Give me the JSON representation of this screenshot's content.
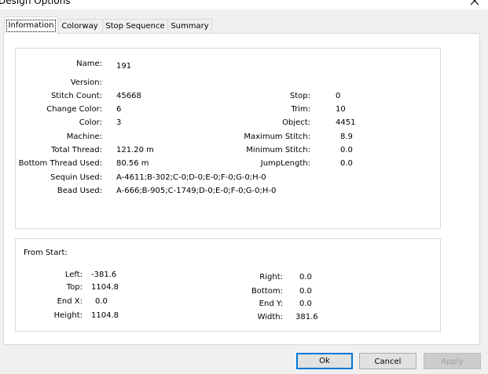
{
  "window": {
    "title": "Design Options"
  },
  "tabs": [
    {
      "label": "Information"
    },
    {
      "label": "Colorway"
    },
    {
      "label": "Stop Sequence"
    },
    {
      "label": "Summary"
    }
  ],
  "info": {
    "name": {
      "label": "Name:",
      "value": "191"
    },
    "version": {
      "label": "Version:",
      "value": ""
    },
    "stitch_count": {
      "label": "Stitch Count:",
      "value": "45668"
    },
    "change_color": {
      "label": "Change Color:",
      "value": "6"
    },
    "color": {
      "label": "Color:",
      "value": "3"
    },
    "machine": {
      "label": "Machine:",
      "value": ""
    },
    "total_thread": {
      "label": "Total Thread:",
      "value": "121.20 m"
    },
    "bottom_thread_used": {
      "label": "Bottom Thread Used:",
      "value": "80.56 m"
    },
    "sequin_used": {
      "label": "Sequin Used:",
      "value": "A-4611;B-302;C-0;D-0;E-0;F-0;G-0;H-0"
    },
    "bead_used": {
      "label": "Bead Used:",
      "value": "A-666;B-905;C-1749;D-0;E-0;F-0;G-0;H-0"
    },
    "stop": {
      "label": "Stop:",
      "value": "0"
    },
    "trim": {
      "label": "Trim:",
      "value": "10"
    },
    "object": {
      "label": "Object:",
      "value": "4451"
    },
    "maximum_stitch": {
      "label": "Maximum Stitch:",
      "value": "8.9"
    },
    "minimum_stitch": {
      "label": "Minimum Stitch:",
      "value": "0.0"
    },
    "jump_length": {
      "label": "JumpLength:",
      "value": "0.0"
    }
  },
  "from_start": {
    "header": "From Start:",
    "left": {
      "label": "Left:",
      "value": "-381.6"
    },
    "top": {
      "label": "Top:",
      "value": "1104.8"
    },
    "end_x": {
      "label": "End X:",
      "value": "0.0"
    },
    "height": {
      "label": "Height:",
      "value": "1104.8"
    },
    "right": {
      "label": "Right:",
      "value": "0.0"
    },
    "bottom": {
      "label": "Bottom:",
      "value": "0.0"
    },
    "end_y": {
      "label": "End Y:",
      "value": "0.0"
    },
    "width": {
      "label": "Width:",
      "value": "381.6"
    }
  },
  "buttons": {
    "ok": "Ok",
    "cancel": "Cancel",
    "apply": "Apply"
  },
  "colors": {
    "accent": "#0078d7",
    "border": "#d9d9d9"
  }
}
